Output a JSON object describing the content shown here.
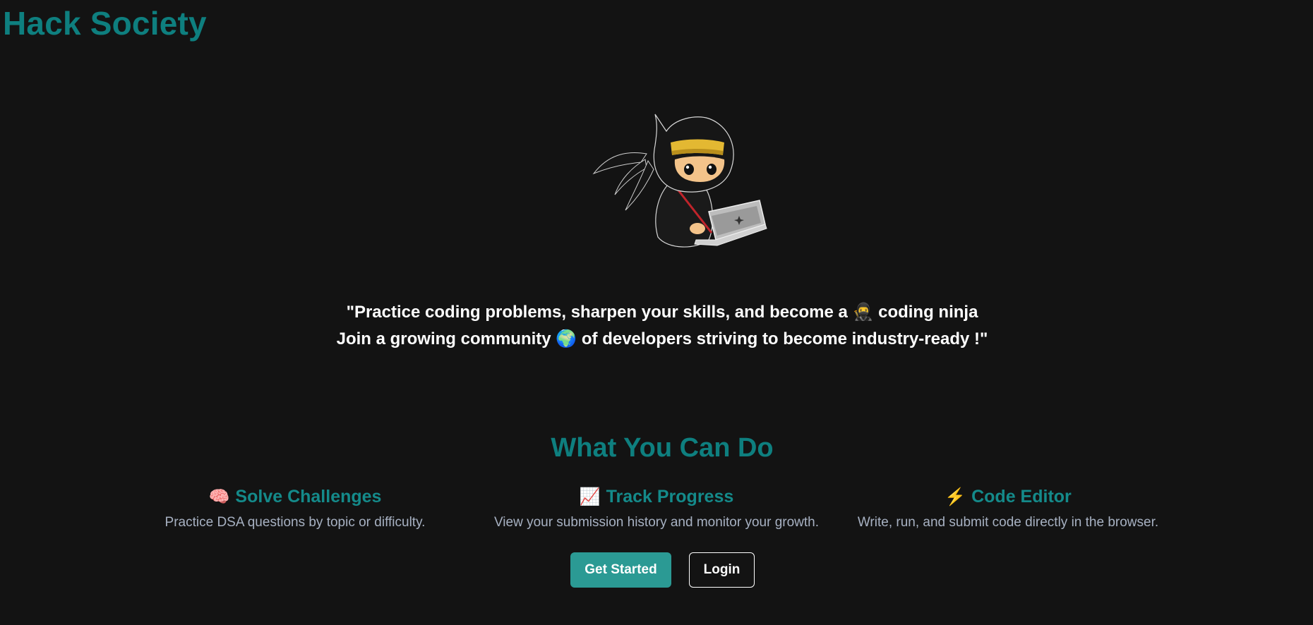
{
  "header": {
    "brand": "Hack Society"
  },
  "hero": {
    "image_alt": "ninja coding on laptop illustration",
    "line1": "\"Practice coding problems, sharpen your skills, and become a",
    "line1_emoji": "🥷",
    "line1_end": "coding ninja",
    "line2": "Join a growing community",
    "line2_emoji": "🌍",
    "line2_end": "of developers striving to become industry-ready !\""
  },
  "features_section": {
    "title": "What You Can Do",
    "items": [
      {
        "icon": "🧠",
        "icon_name": "brain-icon",
        "title": "Solve Challenges",
        "description": "Practice DSA questions by topic or difficulty."
      },
      {
        "icon": "📈",
        "icon_name": "chart-increasing-icon",
        "title": "Track Progress",
        "description": "View your submission history and monitor your growth."
      },
      {
        "icon": "⚡",
        "icon_name": "lightning-icon",
        "title": "Code Editor",
        "description": "Write, run, and submit code directly in the browser."
      }
    ]
  },
  "actions": {
    "get_started_label": "Get Started",
    "login_label": "Login"
  },
  "colors": {
    "background": "#131313",
    "brand_teal": "#0e7f7f",
    "feature_teal": "#148a8a",
    "primary_button": "#2b9a94",
    "muted_text": "#a7b1c2"
  }
}
